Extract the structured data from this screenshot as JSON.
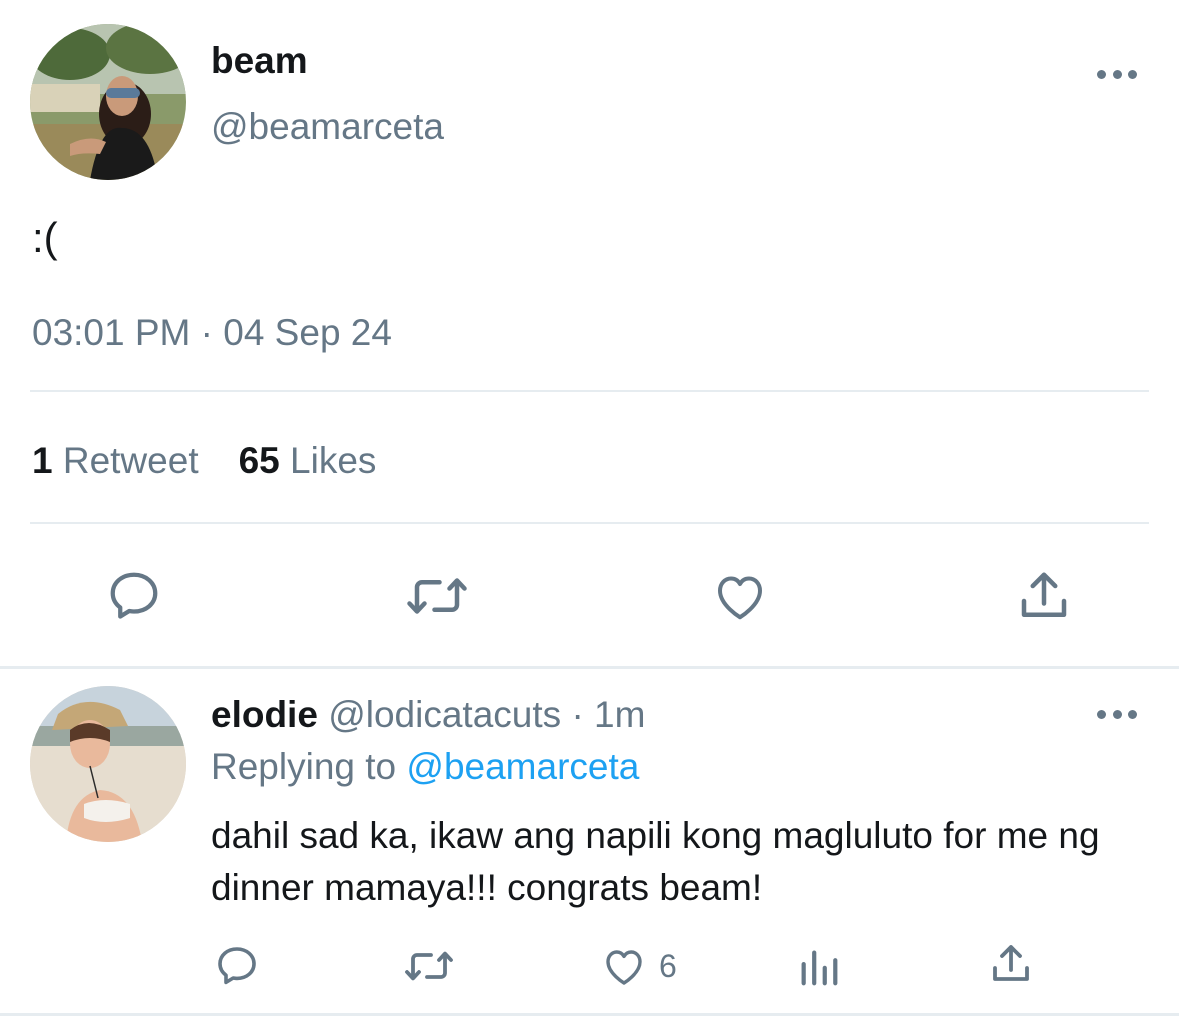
{
  "tweet": {
    "author_name": "beam",
    "author_handle": "@beamarceta",
    "text": ":(",
    "timestamp": "03:01 PM · 04 Sep 24",
    "retweet_count": "1",
    "retweet_label": "Retweet",
    "like_count": "65",
    "like_label": "Likes",
    "actions": [
      "reply-icon",
      "retweet-icon",
      "like-icon",
      "share-icon"
    ]
  },
  "reply": {
    "author_name": "elodie",
    "author_handle": "@lodicatacuts",
    "separator": "·",
    "time": "1m",
    "replying_label": "Replying to",
    "replying_to": "@beamarceta",
    "text": "dahil sad ka, ikaw ang napili kong magluluto for me ng dinner mamaya!!! congrats beam!",
    "like_count": "6",
    "actions": [
      "reply-icon",
      "retweet-icon",
      "like-icon",
      "analytics-icon",
      "share-icon"
    ]
  },
  "colors": {
    "text_primary": "#14171a",
    "text_secondary": "#657786",
    "link": "#1da1f2",
    "divider": "#e6ecf0"
  }
}
